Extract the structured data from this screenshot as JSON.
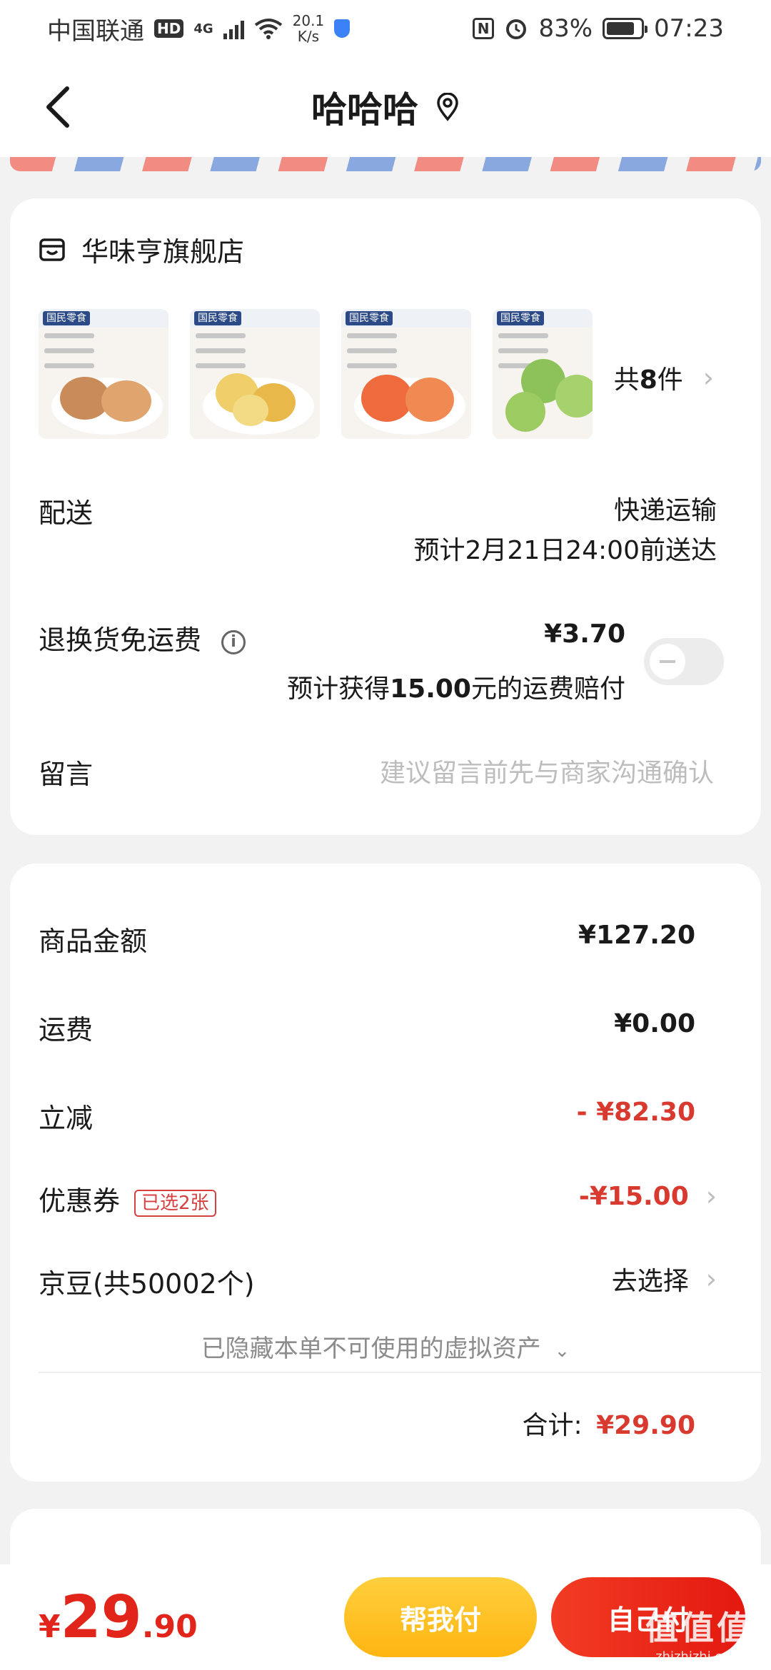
{
  "status_bar": {
    "carrier": "中国联通",
    "hd": "HD",
    "net_type": "4G",
    "net_speed_value": "20.1",
    "net_speed_unit": "K/s",
    "nfc": "N",
    "battery_percent": "83%",
    "battery_level": 0.83,
    "time": "07:23"
  },
  "nav": {
    "title": "哈哈哈"
  },
  "shop": {
    "name": "华味亨旗舰店",
    "item_count_prefix": "共",
    "item_count_value": "8",
    "item_count_suffix": "件",
    "thumbnails": [
      {
        "brand": "国民零食",
        "colors": [
          "#c98b5a",
          "#e0a46e"
        ]
      },
      {
        "brand": "国民零食",
        "colors": [
          "#f0cf6a",
          "#e8b84a"
        ]
      },
      {
        "brand": "国民零食",
        "colors": [
          "#ef6a3c",
          "#f08a52"
        ]
      },
      {
        "brand": "国民零食",
        "colors": [
          "#8dc25a",
          "#a6d26e"
        ]
      }
    ]
  },
  "delivery": {
    "label": "配送",
    "method": "快递运输",
    "eta": "预计2月21日24:00前送达"
  },
  "return_insurance": {
    "label": "退换货免运费",
    "info_glyph": "i",
    "price": "¥3.70",
    "note_prefix": "预计获得",
    "note_amount": "15.00",
    "note_suffix": "元的运费赔付",
    "enabled": false
  },
  "message": {
    "label": "留言",
    "placeholder": "建议留言前先与商家沟通确认"
  },
  "summary": {
    "goods_label": "商品金额",
    "goods_value": "¥127.20",
    "shipping_label": "运费",
    "shipping_value": "¥0.00",
    "discount_label": "立减",
    "discount_value": "- ¥82.30",
    "coupon_label": "优惠券",
    "coupon_tag": "已选2张",
    "coupon_value": "-¥15.00",
    "jd_beans_label": "京豆(共50002个)",
    "jd_beans_action": "去选择",
    "hidden_assets": "已隐藏本单不可使用的虚拟资产",
    "total_label": "合计:",
    "total_value": "¥29.90"
  },
  "bottom": {
    "currency": "¥",
    "price_int": "29",
    "price_dec": ".90",
    "helper_button": "帮我付",
    "self_button": "自己付",
    "watermark_main": "值值值",
    "watermark_sub": "zhizhizhi.com"
  },
  "colors": {
    "accent_red": "#e1251b",
    "discount_red": "#d93a2f",
    "helper_yellow": "#ffc21f"
  }
}
